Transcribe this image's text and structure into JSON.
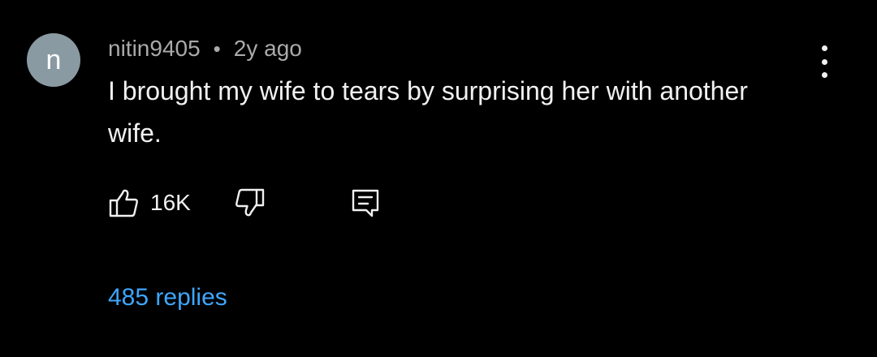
{
  "comment": {
    "avatar_letter": "n",
    "avatar_color": "#8a9aa3",
    "author": "nitin9405",
    "separator": "•",
    "time_ago": "2y ago",
    "text": "I brought my wife to tears by surprising her with another wife.",
    "like_count": "16K",
    "replies_label": "485 replies"
  },
  "icons": {
    "like": "thumbs-up-icon",
    "dislike": "thumbs-down-icon",
    "reply": "reply-comment-icon",
    "more": "more-vertical-icon"
  },
  "colors": {
    "background": "#000000",
    "text_primary": "#f1f1f1",
    "text_secondary": "#aaaaaa",
    "link": "#3ea6ff"
  }
}
